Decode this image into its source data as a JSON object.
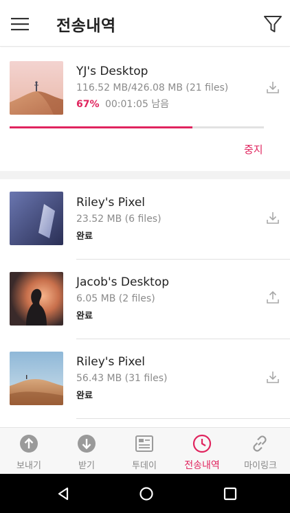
{
  "header": {
    "title": "전송내역",
    "menu_icon": "hamburger-menu-icon",
    "filter_icon": "filter-icon"
  },
  "active_transfer": {
    "name": "YJ's Desktop",
    "size_info": "116.52 MB/426.08 MB (21 files)",
    "percent": "67%",
    "remaining": "00:01:05 남음",
    "progress": 0.72,
    "stop_label": "중지",
    "action_icon": "download-icon"
  },
  "history": [
    {
      "name": "Riley's Pixel",
      "size_info": "23.52 MB (6 files)",
      "status": "완료",
      "action_icon": "download-icon"
    },
    {
      "name": "Jacob's Desktop",
      "size_info": "6.05 MB (2 files)",
      "status": "완료",
      "action_icon": "upload-icon"
    },
    {
      "name": "Riley's Pixel",
      "size_info": "56.43 MB (31 files)",
      "status": "완료",
      "action_icon": "download-icon"
    }
  ],
  "tabs": [
    {
      "label": "보내기",
      "icon": "send-arrow-up-icon"
    },
    {
      "label": "받기",
      "icon": "receive-arrow-down-icon"
    },
    {
      "label": "투데이",
      "icon": "today-card-icon"
    },
    {
      "label": "전송내역",
      "icon": "clock-history-icon",
      "active": true
    },
    {
      "label": "마이링크",
      "icon": "link-icon"
    }
  ],
  "colors": {
    "accent": "#e0245e",
    "text": "#222222",
    "muted": "#8a8a8a"
  }
}
